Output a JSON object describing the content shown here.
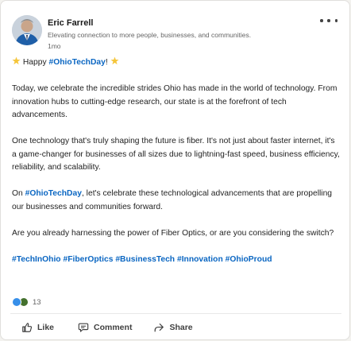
{
  "post": {
    "author": {
      "name": "Eric Farrell",
      "headline": "Elevating connection to more people, businesses, and communities.",
      "time_ago": "1mo"
    },
    "body": {
      "greeting_prefix": "Happy ",
      "greeting_tag": "#OhioTechDay",
      "greeting_suffix": "!",
      "para1": "Today, we celebrate the incredible strides Ohio has made in the world of technology. From innovation hubs to cutting-edge research, our state is at the forefront of tech advancements.",
      "para2": "One technology that's truly shaping the future is fiber. It's not just about faster internet, it's a game-changer for businesses of all sizes due to lightning-fast speed, business efficiency, reliability, and scalability.",
      "para3_prefix": "On ",
      "para3_tag": "#OhioTechDay",
      "para3_suffix": ", let's celebrate these technological advancements that are propelling our businesses and communities forward.",
      "para4": "Are you already harnessing the power of Fiber Optics, or are you considering the switch?",
      "hashtags": [
        "#TechInOhio",
        "#FiberOptics",
        "#BusinessTech",
        "#Innovation",
        "#OhioProud"
      ]
    },
    "reactions": {
      "icons": [
        "like-reaction-icon",
        "celebrate-reaction-icon"
      ],
      "count": "13"
    },
    "actions": {
      "like": "Like",
      "comment": "Comment",
      "share": "Share"
    }
  },
  "colors": {
    "link": "#0a66c2",
    "like_blue": "#378fe9",
    "celebrate_green": "#44712e",
    "star": "#f5c53a"
  }
}
